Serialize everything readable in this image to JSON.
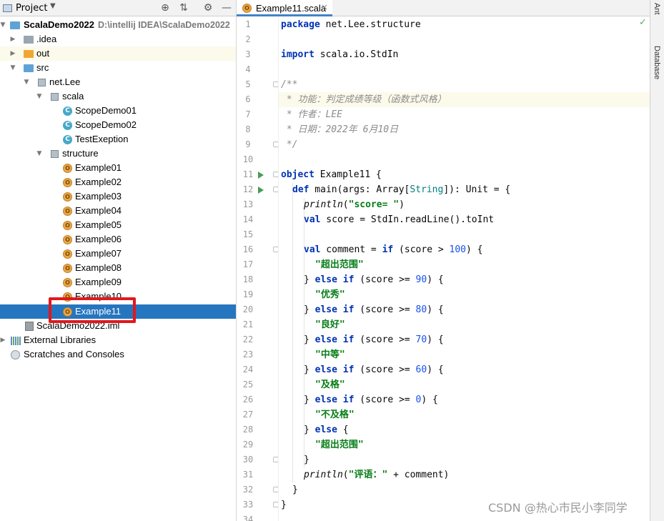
{
  "project_panel": {
    "title": "Project",
    "caret": "▼",
    "tools": [
      "⊕",
      "⇅",
      "⚙",
      "—"
    ],
    "root": {
      "label": "ScalaDemo2022",
      "path": "D:\\intellij IDEA\\ScalaDemo2022"
    },
    "items": {
      "idea": ".idea",
      "out": "out",
      "src": "src",
      "netlee": "net.Lee",
      "scala": "scala",
      "scope1": "ScopeDemo01",
      "scope2": "ScopeDemo02",
      "testex": "TestExeption",
      "structure": "structure",
      "ex01": "Example01",
      "ex02": "Example02",
      "ex03": "Example03",
      "ex04": "Example04",
      "ex05": "Example05",
      "ex06": "Example06",
      "ex07": "Example07",
      "ex08": "Example08",
      "ex09": "Example09",
      "ex10": "Example10",
      "ex11": "Example11",
      "iml": "ScalaDemo2022.iml",
      "libs": "External Libraries",
      "scratches": "Scratches and Consoles"
    }
  },
  "editor": {
    "tab": {
      "label": "Example11.scala",
      "close": "×"
    },
    "line_numbers": [
      "1",
      "2",
      "3",
      "4",
      "5",
      "6",
      "7",
      "8",
      "9",
      "10",
      "11",
      "12",
      "13",
      "14",
      "15",
      "16",
      "17",
      "18",
      "19",
      "20",
      "21",
      "22",
      "23",
      "24",
      "25",
      "26",
      "27",
      "28",
      "29",
      "30",
      "31",
      "32",
      "33",
      "34"
    ],
    "code": {
      "l1_kw": "package",
      "l1_rest": " net.Lee.structure",
      "l3_kw": "import",
      "l3_rest": " scala.io.StdIn",
      "l5": "/**",
      "l6": " * 功能：判定成绩等级（函数式风格）",
      "l7": " * 作者：LEE",
      "l8": " * 日期：2022年 6月10日",
      "l9": " */",
      "l11_kw": "object",
      "l11_rest": " Example11 {",
      "l12_kw": "def",
      "l12_a": " main(args: Array[",
      "l12_type": "String",
      "l12_b": "]): Unit = {",
      "l13_fn": "println",
      "l13_a": "(",
      "l13_str": "\"score= \"",
      "l13_b": ")",
      "l14_kw": "val",
      "l14_rest": " score = StdIn.readLine().toInt",
      "l16_kw": "val",
      "l16_a": " comment = ",
      "l16_kw2": "if",
      "l16_b": " (score > ",
      "l16_num": "100",
      "l16_c": ") {",
      "l17_str": "\"超出范围\"",
      "l18_a": "} ",
      "l18_kw": "else if",
      "l18_b": " (score >= ",
      "l18_num": "90",
      "l18_c": ") {",
      "l19_str": "\"优秀\"",
      "l20_a": "} ",
      "l20_kw": "else if",
      "l20_b": " (score >= ",
      "l20_num": "80",
      "l20_c": ") {",
      "l21_str": "\"良好\"",
      "l22_a": "} ",
      "l22_kw": "else if",
      "l22_b": " (score >= ",
      "l22_num": "70",
      "l22_c": ") {",
      "l23_str": "\"中等\"",
      "l24_a": "} ",
      "l24_kw": "else if",
      "l24_b": " (score >= ",
      "l24_num": "60",
      "l24_c": ") {",
      "l25_str": "\"及格\"",
      "l26_a": "} ",
      "l26_kw": "else if",
      "l26_b": " (score >= ",
      "l26_num": "0",
      "l26_c": ") {",
      "l27_str": "\"不及格\"",
      "l28_a": "} ",
      "l28_kw": "else",
      "l28_b": " {",
      "l29_str": "\"超出范围\"",
      "l30": "}",
      "l31_fn": "println",
      "l31_a": "(",
      "l31_str": "\"评语：\"",
      "l31_b": " + comment)",
      "l32": "}",
      "l33": "}"
    }
  },
  "right_strip": {
    "ant": "Ant",
    "database": "Database"
  },
  "status": {
    "check": "✓"
  },
  "watermark": "CSDN @热心市民小李同学"
}
